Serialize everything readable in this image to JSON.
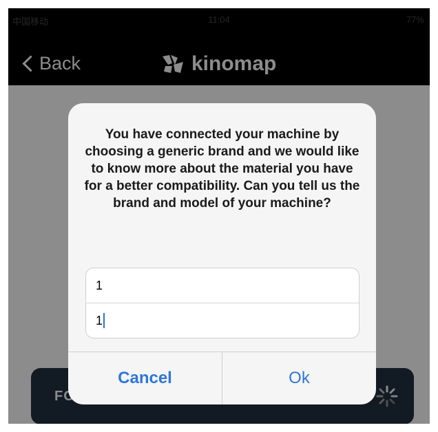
{
  "status_bar": {
    "carrier": "中国移动",
    "time": "11:04",
    "battery": "77%"
  },
  "nav": {
    "back_label": "Back",
    "brand_name": "kinomap"
  },
  "footer": {
    "label": "FO"
  },
  "dialog": {
    "message": "You have connected your machine by choosing a generic brand and we would like to know more about the material you have for a better compatibility. Can you tell us the brand and model of your machine?",
    "brand_field_value": "1",
    "model_field_value": "1",
    "cancel_label": "Cancel",
    "ok_label": "Ok"
  },
  "colors": {
    "accent": "#2e77d6",
    "overlay": "#8c8c8c",
    "dialog_bg": "#f5f5f5"
  }
}
